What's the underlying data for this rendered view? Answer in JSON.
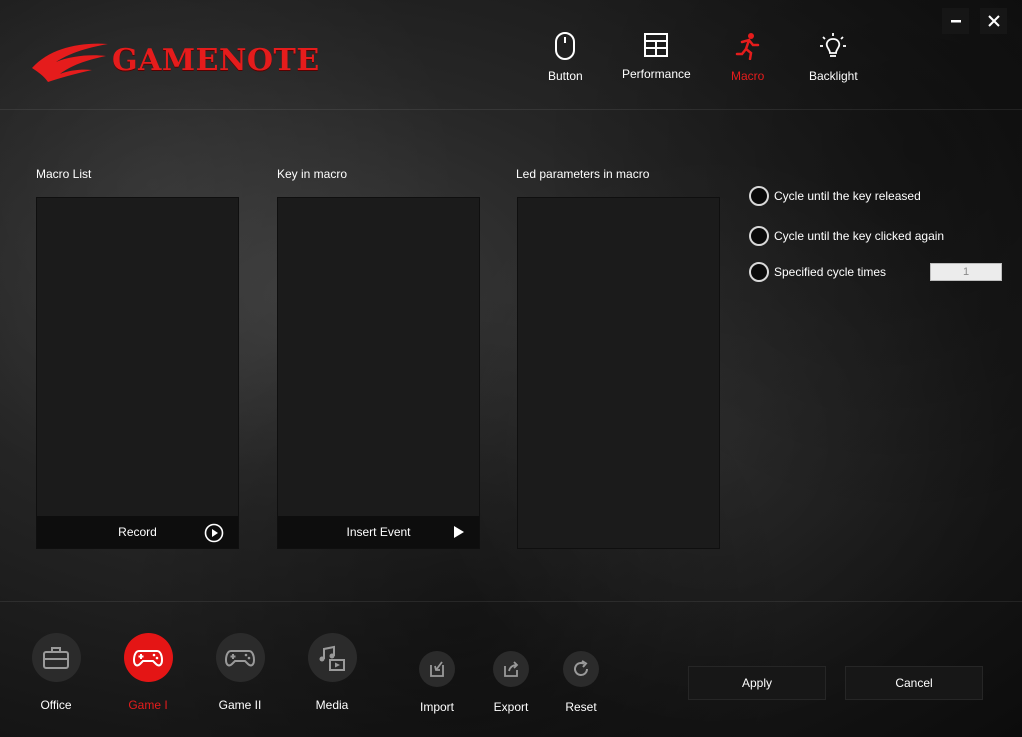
{
  "app": {
    "brand": "GAMENOTE"
  },
  "window": {
    "minimize_label": "minimize",
    "close_label": "close"
  },
  "nav": {
    "tabs": [
      {
        "label": "Button",
        "icon": "mouse-icon",
        "active": false
      },
      {
        "label": "Performance",
        "icon": "grid-icon",
        "active": false
      },
      {
        "label": "Macro",
        "icon": "running-man-icon",
        "active": true
      },
      {
        "label": "Backlight",
        "icon": "lightbulb-icon",
        "active": false
      }
    ]
  },
  "macro": {
    "list_title": "Macro List",
    "keys_title": "Key in macro",
    "led_title": "Led parameters in macro",
    "record_label": "Record",
    "insert_label": "Insert Event"
  },
  "options": {
    "cycle_released": "Cycle until the key released",
    "cycle_clicked": "Cycle until the key clicked again",
    "cycle_times": "Specified cycle times",
    "cycle_times_value": "1"
  },
  "modes": [
    {
      "label": "Office",
      "icon": "briefcase-icon",
      "active": false
    },
    {
      "label": "Game I",
      "icon": "gamepad-icon",
      "active": true
    },
    {
      "label": "Game II",
      "icon": "gamepad-icon",
      "active": false
    },
    {
      "label": "Media",
      "icon": "media-icon",
      "active": false
    }
  ],
  "actions": {
    "import": "Import",
    "export": "Export",
    "reset": "Reset"
  },
  "buttons": {
    "apply": "Apply",
    "cancel": "Cancel"
  },
  "colors": {
    "accent": "#e51c1c",
    "panel": "#1b1b1b",
    "footer": "#0d0d0d"
  }
}
